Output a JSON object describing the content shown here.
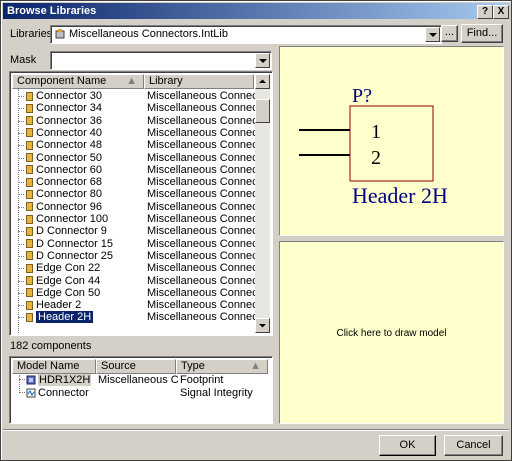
{
  "window": {
    "title": "Browse Libraries"
  },
  "title_buttons": {
    "help": "?",
    "close": "X"
  },
  "libraries": {
    "label": "Libraries",
    "value": "Miscellaneous Connectors.IntLib",
    "browse": "...",
    "find": "Find..."
  },
  "mask": {
    "label": "Mask",
    "value": ""
  },
  "components": {
    "col_name": "Component Name",
    "col_library": "Library",
    "rows": [
      {
        "name": "Connector 30",
        "library": "Miscellaneous Connectors.IntLib"
      },
      {
        "name": "Connector 34",
        "library": "Miscellaneous Connectors.IntLib"
      },
      {
        "name": "Connector 36",
        "library": "Miscellaneous Connectors.IntLib"
      },
      {
        "name": "Connector 40",
        "library": "Miscellaneous Connectors.IntLib"
      },
      {
        "name": "Connector 48",
        "library": "Miscellaneous Connectors.IntLib"
      },
      {
        "name": "Connector 50",
        "library": "Miscellaneous Connectors.IntLib"
      },
      {
        "name": "Connector 60",
        "library": "Miscellaneous Connectors.IntLib"
      },
      {
        "name": "Connector 68",
        "library": "Miscellaneous Connectors.IntLib"
      },
      {
        "name": "Connector 80",
        "library": "Miscellaneous Connectors.IntLib"
      },
      {
        "name": "Connector 96",
        "library": "Miscellaneous Connectors.IntLib"
      },
      {
        "name": "Connector 100",
        "library": "Miscellaneous Connectors.IntLib"
      },
      {
        "name": "D Connector 9",
        "library": "Miscellaneous Connectors.IntLib"
      },
      {
        "name": "D Connector 15",
        "library": "Miscellaneous Connectors.IntLib"
      },
      {
        "name": "D Connector 25",
        "library": "Miscellaneous Connectors.IntLib"
      },
      {
        "name": "Edge Con 22",
        "library": "Miscellaneous Connectors.IntLib"
      },
      {
        "name": "Edge Con 44",
        "library": "Miscellaneous Connectors.IntLib"
      },
      {
        "name": "Edge Con 50",
        "library": "Miscellaneous Connectors.IntLib"
      },
      {
        "name": "Header 2",
        "library": "Miscellaneous Connectors.IntLib"
      },
      {
        "name": "Header 2H",
        "library": "Miscellaneous Connectors.IntLib",
        "selected": true
      }
    ],
    "count": "182 components"
  },
  "models": {
    "col_name": "Model Name",
    "col_source": "Source",
    "col_type": "Type",
    "rows": [
      {
        "name": "HDR1X2H",
        "source": "Miscellaneous Conne",
        "type": "Footprint",
        "icon": "footprint-icon"
      },
      {
        "name": "Connector",
        "source": "",
        "type": "Signal Integrity",
        "icon": "signal-integrity-icon"
      }
    ]
  },
  "symbol": {
    "designator": "P?",
    "pin1": "1",
    "pin2": "2",
    "comment": "Header 2H"
  },
  "model_preview": {
    "text": "Click here to draw model"
  },
  "buttons": {
    "ok": "OK",
    "cancel": "Cancel"
  },
  "colors": {
    "title_start": "#0a246a",
    "title_end": "#a6caf0",
    "preview_bg": "#ffffcc",
    "symbol_text": "#000080",
    "body_stroke": "#8b0000"
  }
}
